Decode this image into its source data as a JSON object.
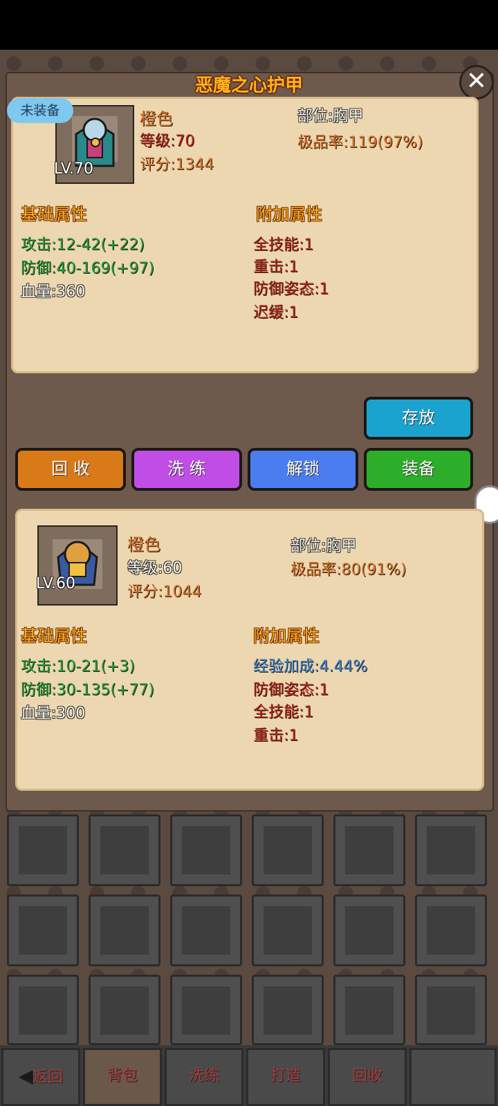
{
  "item1": {
    "name": "恶魔之心护甲",
    "badge": "未装备",
    "level_tag": "LV.70",
    "quality": "橙色",
    "level": "等级:70",
    "score": "评分:1344",
    "slot": "部位:胸甲",
    "rarity": "极品率:119(97%)",
    "base_title": "基础属性",
    "extra_title": "附加属性",
    "base": [
      "攻击:12-42(+22)",
      "防御:40-169(+97)",
      "血量:360"
    ],
    "extra": [
      "全技能:1",
      "重击:1",
      "防御姿态:1",
      "迟缓:1"
    ]
  },
  "buttons": {
    "store": "存放",
    "recycle": "回 收",
    "wash": "洗 练",
    "unlock": "解锁",
    "equip": "装备"
  },
  "item2": {
    "level_tag": "LV.60",
    "quality": "橙色",
    "level": "等级:60",
    "score": "评分:1044",
    "slot": "部位:胸甲",
    "rarity": "极品率:80(91%)",
    "base_title": "基础属性",
    "extra_title": "附加属性",
    "base": [
      "攻击:10-21(+3)",
      "防御:30-135(+77)",
      "血量:300"
    ],
    "extra": [
      "经验加成:4.44%",
      "防御姿态:1",
      "全技能:1",
      "重击:1"
    ]
  },
  "tabs": [
    "返回",
    "背包",
    "洗练",
    "打造",
    "回收",
    ""
  ],
  "active_tab": "背包"
}
